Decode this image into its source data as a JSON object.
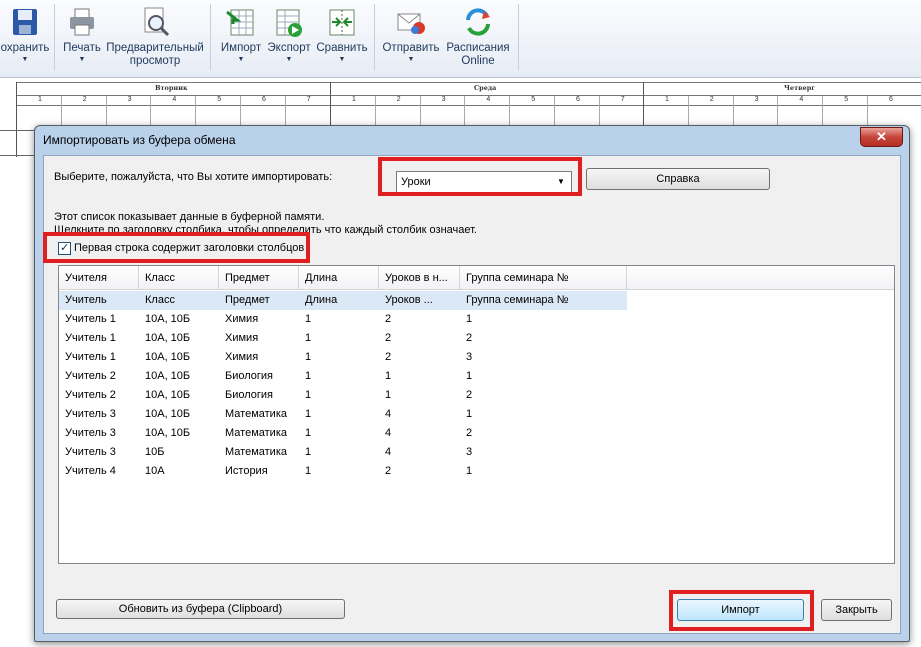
{
  "toolbar": {
    "save_label": "охранить",
    "print_label": "Печать",
    "preview_label_1": "Предварительный",
    "preview_label_2": "просмотр",
    "import_label": "Импорт",
    "export_label": "Экспорт",
    "compare_label": "Сравнить",
    "send_label": "Отправить",
    "online_label_1": "Расписания",
    "online_label_2": "Online",
    "dropdown_glyph": "▼"
  },
  "timetable": {
    "days": [
      "Вторник",
      "Среда",
      "Четверг"
    ],
    "period_numbers": [
      "1",
      "2",
      "3",
      "4",
      "5",
      "6",
      "7",
      "1",
      "2",
      "3",
      "4",
      "5",
      "6",
      "7",
      "1",
      "2",
      "3",
      "4",
      "5",
      "6"
    ]
  },
  "dialog": {
    "title": "Импортировать из буфера обмена",
    "close_glyph": "✕",
    "choose_label": "Выберите, пожалуйста, что Вы хотите импортировать:",
    "combo_value": "Уроки",
    "combo_arrow": "▼",
    "help_button": "Справка",
    "info_line_1": "Этот список показывает данные в буферной памяти.",
    "info_line_2": "Щелкните по заголовку столбика, чтобы определить что каждый столбик означает.",
    "checkbox_label": "Первая строка содержит заголовки столбцов",
    "checkbox_checked": true,
    "refresh_button": "Обновить из буфера (Clipboard)",
    "import_button": "Импорт",
    "close_button": "Закрыть",
    "table": {
      "headers": [
        "Учителя",
        "Класс",
        "Предмет",
        "Длина",
        "Уроков в н...",
        "Группа семинара №"
      ],
      "rows": [
        [
          "Учитель",
          "Класс",
          "Предмет",
          "Длина",
          "Уроков ...",
          "Группа семинара №"
        ],
        [
          "Учитель 1",
          "10А, 10Б",
          "Химия",
          "1",
          "2",
          "1"
        ],
        [
          "Учитель 1",
          "10А, 10Б",
          "Химия",
          "1",
          "2",
          "2"
        ],
        [
          "Учитель 1",
          "10А, 10Б",
          "Химия",
          "1",
          "2",
          "3"
        ],
        [
          "Учитель 2",
          "10А, 10Б",
          "Биология",
          "1",
          "1",
          "1"
        ],
        [
          "Учитель 2",
          "10А, 10Б",
          "Биология",
          "1",
          "1",
          "2"
        ],
        [
          "Учитель 3",
          "10А, 10Б",
          "Математика",
          "1",
          "4",
          "1"
        ],
        [
          "Учитель 3",
          "10А, 10Б",
          "Математика",
          "1",
          "4",
          "2"
        ],
        [
          "Учитель 3",
          "10Б",
          "Математика",
          "1",
          "4",
          "3"
        ],
        [
          "Учитель 4",
          "10А",
          "История",
          "1",
          "2",
          "1"
        ]
      ]
    }
  },
  "colors": {
    "highlight_border": "#e02020",
    "dialog_frame": "#b9d1ea",
    "selected_row": "#dbe8f5"
  }
}
